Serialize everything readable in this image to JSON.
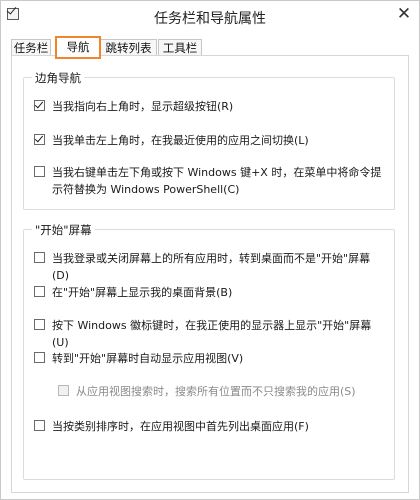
{
  "window": {
    "title": "任务栏和导航属性",
    "close_glyph": "✕"
  },
  "tabs": [
    {
      "label": "任务栏",
      "active": false
    },
    {
      "label": "导航",
      "active": true
    },
    {
      "label": "跳转列表",
      "active": false
    },
    {
      "label": "工具栏",
      "active": false
    }
  ],
  "corner_navigation": {
    "title": "边角导航",
    "options": [
      {
        "label": "当我指向右上角时，显示超级按钮(R)",
        "checked": true
      },
      {
        "label": "当我单击左上角时，在我最近使用的应用之间切换(L)",
        "checked": true
      },
      {
        "label": "当我右键单击左下角或按下 Windows 键+X 时，在菜单中将命令提示符替换为 Windows PowerShell(C)",
        "checked": false
      }
    ]
  },
  "start_screen": {
    "title": "\"开始\"屏幕",
    "options": [
      {
        "label": "当我登录或关闭屏幕上的所有应用时，转到桌面而不是\"开始\"屏幕(D)",
        "checked": false,
        "disabled": false
      },
      {
        "label": "在\"开始\"屏幕上显示我的桌面背景(B)",
        "checked": false,
        "disabled": false
      },
      {
        "label": "按下 Windows 徽标键时，在我正使用的显示器上显示\"开始\"屏幕(U)",
        "checked": false,
        "disabled": false
      },
      {
        "label": "转到\"开始\"屏幕时自动显示应用视图(V)",
        "checked": false,
        "disabled": false
      },
      {
        "label": "从应用视图搜索时，搜索所有位置而不只搜索我的应用(S)",
        "checked": false,
        "disabled": true
      },
      {
        "label": "当按类别排序时，在应用视图中首先列出桌面应用(F)",
        "checked": false,
        "disabled": false
      }
    ]
  }
}
